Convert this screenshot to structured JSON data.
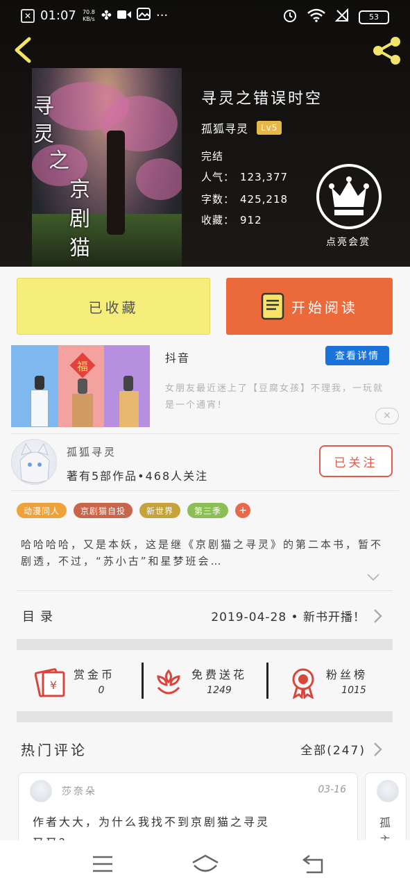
{
  "status_bar": {
    "time": "01:07",
    "net_speed": "70.8 KB/s",
    "battery": "53"
  },
  "book": {
    "title": "寻灵之错误时空",
    "author": "孤狐寻灵",
    "level": "Lv5",
    "status": "完结",
    "stats": [
      {
        "label": "人气：",
        "value": "123,377"
      },
      {
        "label": "字数：",
        "value": "425,218"
      },
      {
        "label": "收藏：",
        "value": "912"
      }
    ],
    "cover_text": [
      "寻",
      "灵",
      "之",
      "京",
      "剧",
      "猫"
    ],
    "reward_label": "点亮会赏"
  },
  "actions": {
    "saved_label": "已收藏",
    "read_label": "开始阅读"
  },
  "ad": {
    "title": "抖音",
    "detail_button": "查看详情",
    "description": "女朋友最近迷上了【豆腐女孩】不理我，一玩就是一个通宵！",
    "image_label": "福"
  },
  "author": {
    "name": "孤狐寻灵",
    "works": "著有5部作品•468人关注",
    "follow_label": "已关注"
  },
  "tags": [
    {
      "label": "动漫同人",
      "color": "#f0a23a"
    },
    {
      "label": "京剧猫自投",
      "color": "#c9654a"
    },
    {
      "label": "新世界",
      "color": "#c5a33a"
    },
    {
      "label": "第三季",
      "color": "#8bbf55"
    }
  ],
  "intro": "哈哈哈哈，又是本妖，这是继《京剧猫之寻灵》的第二本书，暂不剧透，不过，“苏小古”和星梦班会…",
  "catalog": {
    "label": "目录",
    "update": "2019-04-28 • 新书开播！"
  },
  "rewards": [
    {
      "name": "赏金币",
      "value": "0",
      "icon": "gold-envelope-icon",
      "color": "#d9453a"
    },
    {
      "name": "免费送花",
      "value": "1249",
      "icon": "flower-icon",
      "color": "#d9453a"
    },
    {
      "name": "粉丝榜",
      "value": "1015",
      "icon": "medal-icon",
      "color": "#d9453a"
    }
  ],
  "comments": {
    "title": "热门评论",
    "all_label": "全部(247)",
    "items": [
      {
        "user": "莎奈朵",
        "date": "03-16",
        "text": "作者大大，为什么我找不到京剧猫之寻灵",
        "text2": "又又？"
      }
    ],
    "peek_text": [
      "孤",
      "主"
    ]
  }
}
